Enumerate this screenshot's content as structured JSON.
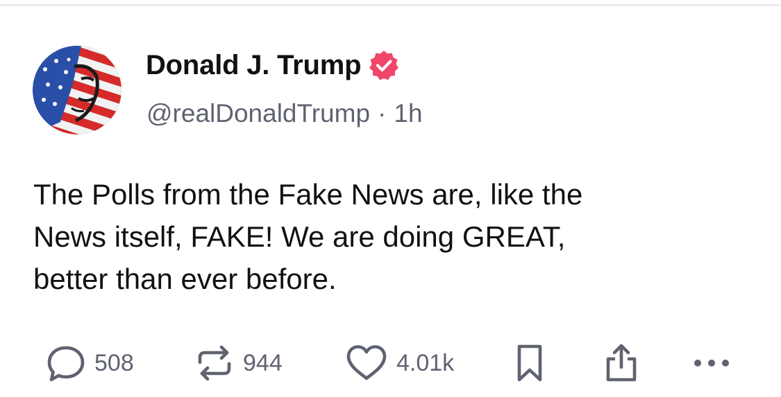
{
  "post": {
    "author": {
      "display_name": "Donald J. Trump",
      "verified_icon": "verified-badge-icon",
      "handle": "@realDonaldTrump",
      "avatar": "avatar-flag-portrait"
    },
    "separator": "·",
    "timestamp": "1h",
    "body_lines": [
      "The Polls from the Fake News are, like the",
      "News itself, FAKE! We are doing GREAT,",
      "better than ever before."
    ],
    "actions": {
      "reply": {
        "icon": "reply-icon",
        "count": "508"
      },
      "repost": {
        "icon": "repost-icon",
        "count": "944"
      },
      "like": {
        "icon": "heart-icon",
        "count": "4.01k"
      },
      "bookmark": {
        "icon": "bookmark-icon"
      },
      "share": {
        "icon": "share-icon"
      },
      "more": {
        "icon": "more-icon"
      }
    }
  },
  "colors": {
    "text": "#111111",
    "secondary_text": "#5f6270",
    "verified_badge": "#f0466a",
    "icon": "#5f6270",
    "divider": "#ececef"
  }
}
